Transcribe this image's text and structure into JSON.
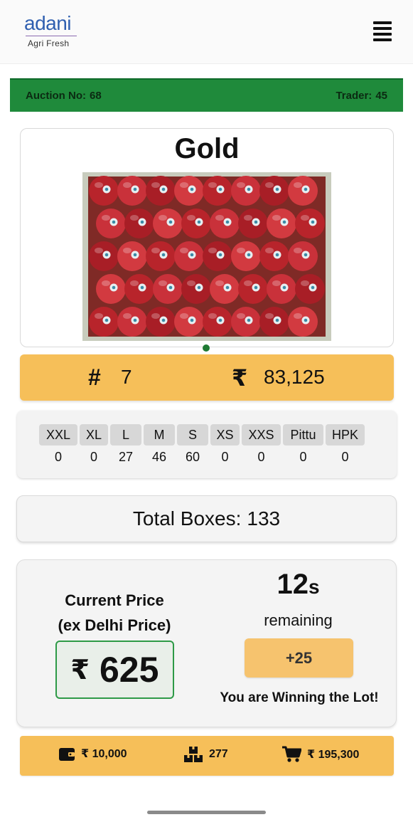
{
  "header": {
    "logo_word": "adani",
    "logo_subtitle": "Agri Fresh",
    "menu_icon": "hamburger-menu-icon"
  },
  "auction": {
    "auction_label": "Auction No:",
    "auction_no": "68",
    "trader_label": "Trader:",
    "trader_no": "45",
    "bar_color": "#1f8a3b"
  },
  "product": {
    "title": "Gold",
    "image": "apple-box-photo"
  },
  "lot_summary": {
    "hash_symbol": "#",
    "lot_number": "7",
    "rupee_symbol": "₹",
    "total_amount": "83,125",
    "accent_color": "#f6bf59"
  },
  "grades": [
    {
      "label": "XXL",
      "count": "0"
    },
    {
      "label": "XL",
      "count": "0"
    },
    {
      "label": "L",
      "count": "27"
    },
    {
      "label": "M",
      "count": "46"
    },
    {
      "label": "S",
      "count": "60"
    },
    {
      "label": "XS",
      "count": "0"
    },
    {
      "label": "XXS",
      "count": "0"
    },
    {
      "label": "Pittu",
      "count": "0"
    },
    {
      "label": "HPK",
      "count": "0"
    }
  ],
  "total_boxes": {
    "label": "Total Boxes:",
    "value": "133"
  },
  "bidding": {
    "current_price_label": "Current Price",
    "price_note": "(ex Delhi Price)",
    "rupee_symbol": "₹",
    "current_price": "625",
    "timer_value": "12",
    "timer_unit": "s",
    "remaining_label": "remaining",
    "bid_increment_label": "+25",
    "status_message": "You are Winning the Lot!",
    "price_border_color": "#2e9a47"
  },
  "footer": {
    "wallet_icon": "wallet-icon",
    "wallet_amount": "₹ 10,000",
    "boxes_icon": "stacked-boxes-icon",
    "boxes_count": "277",
    "cart_icon": "shopping-cart-icon",
    "cart_amount": "₹ 195,300"
  }
}
